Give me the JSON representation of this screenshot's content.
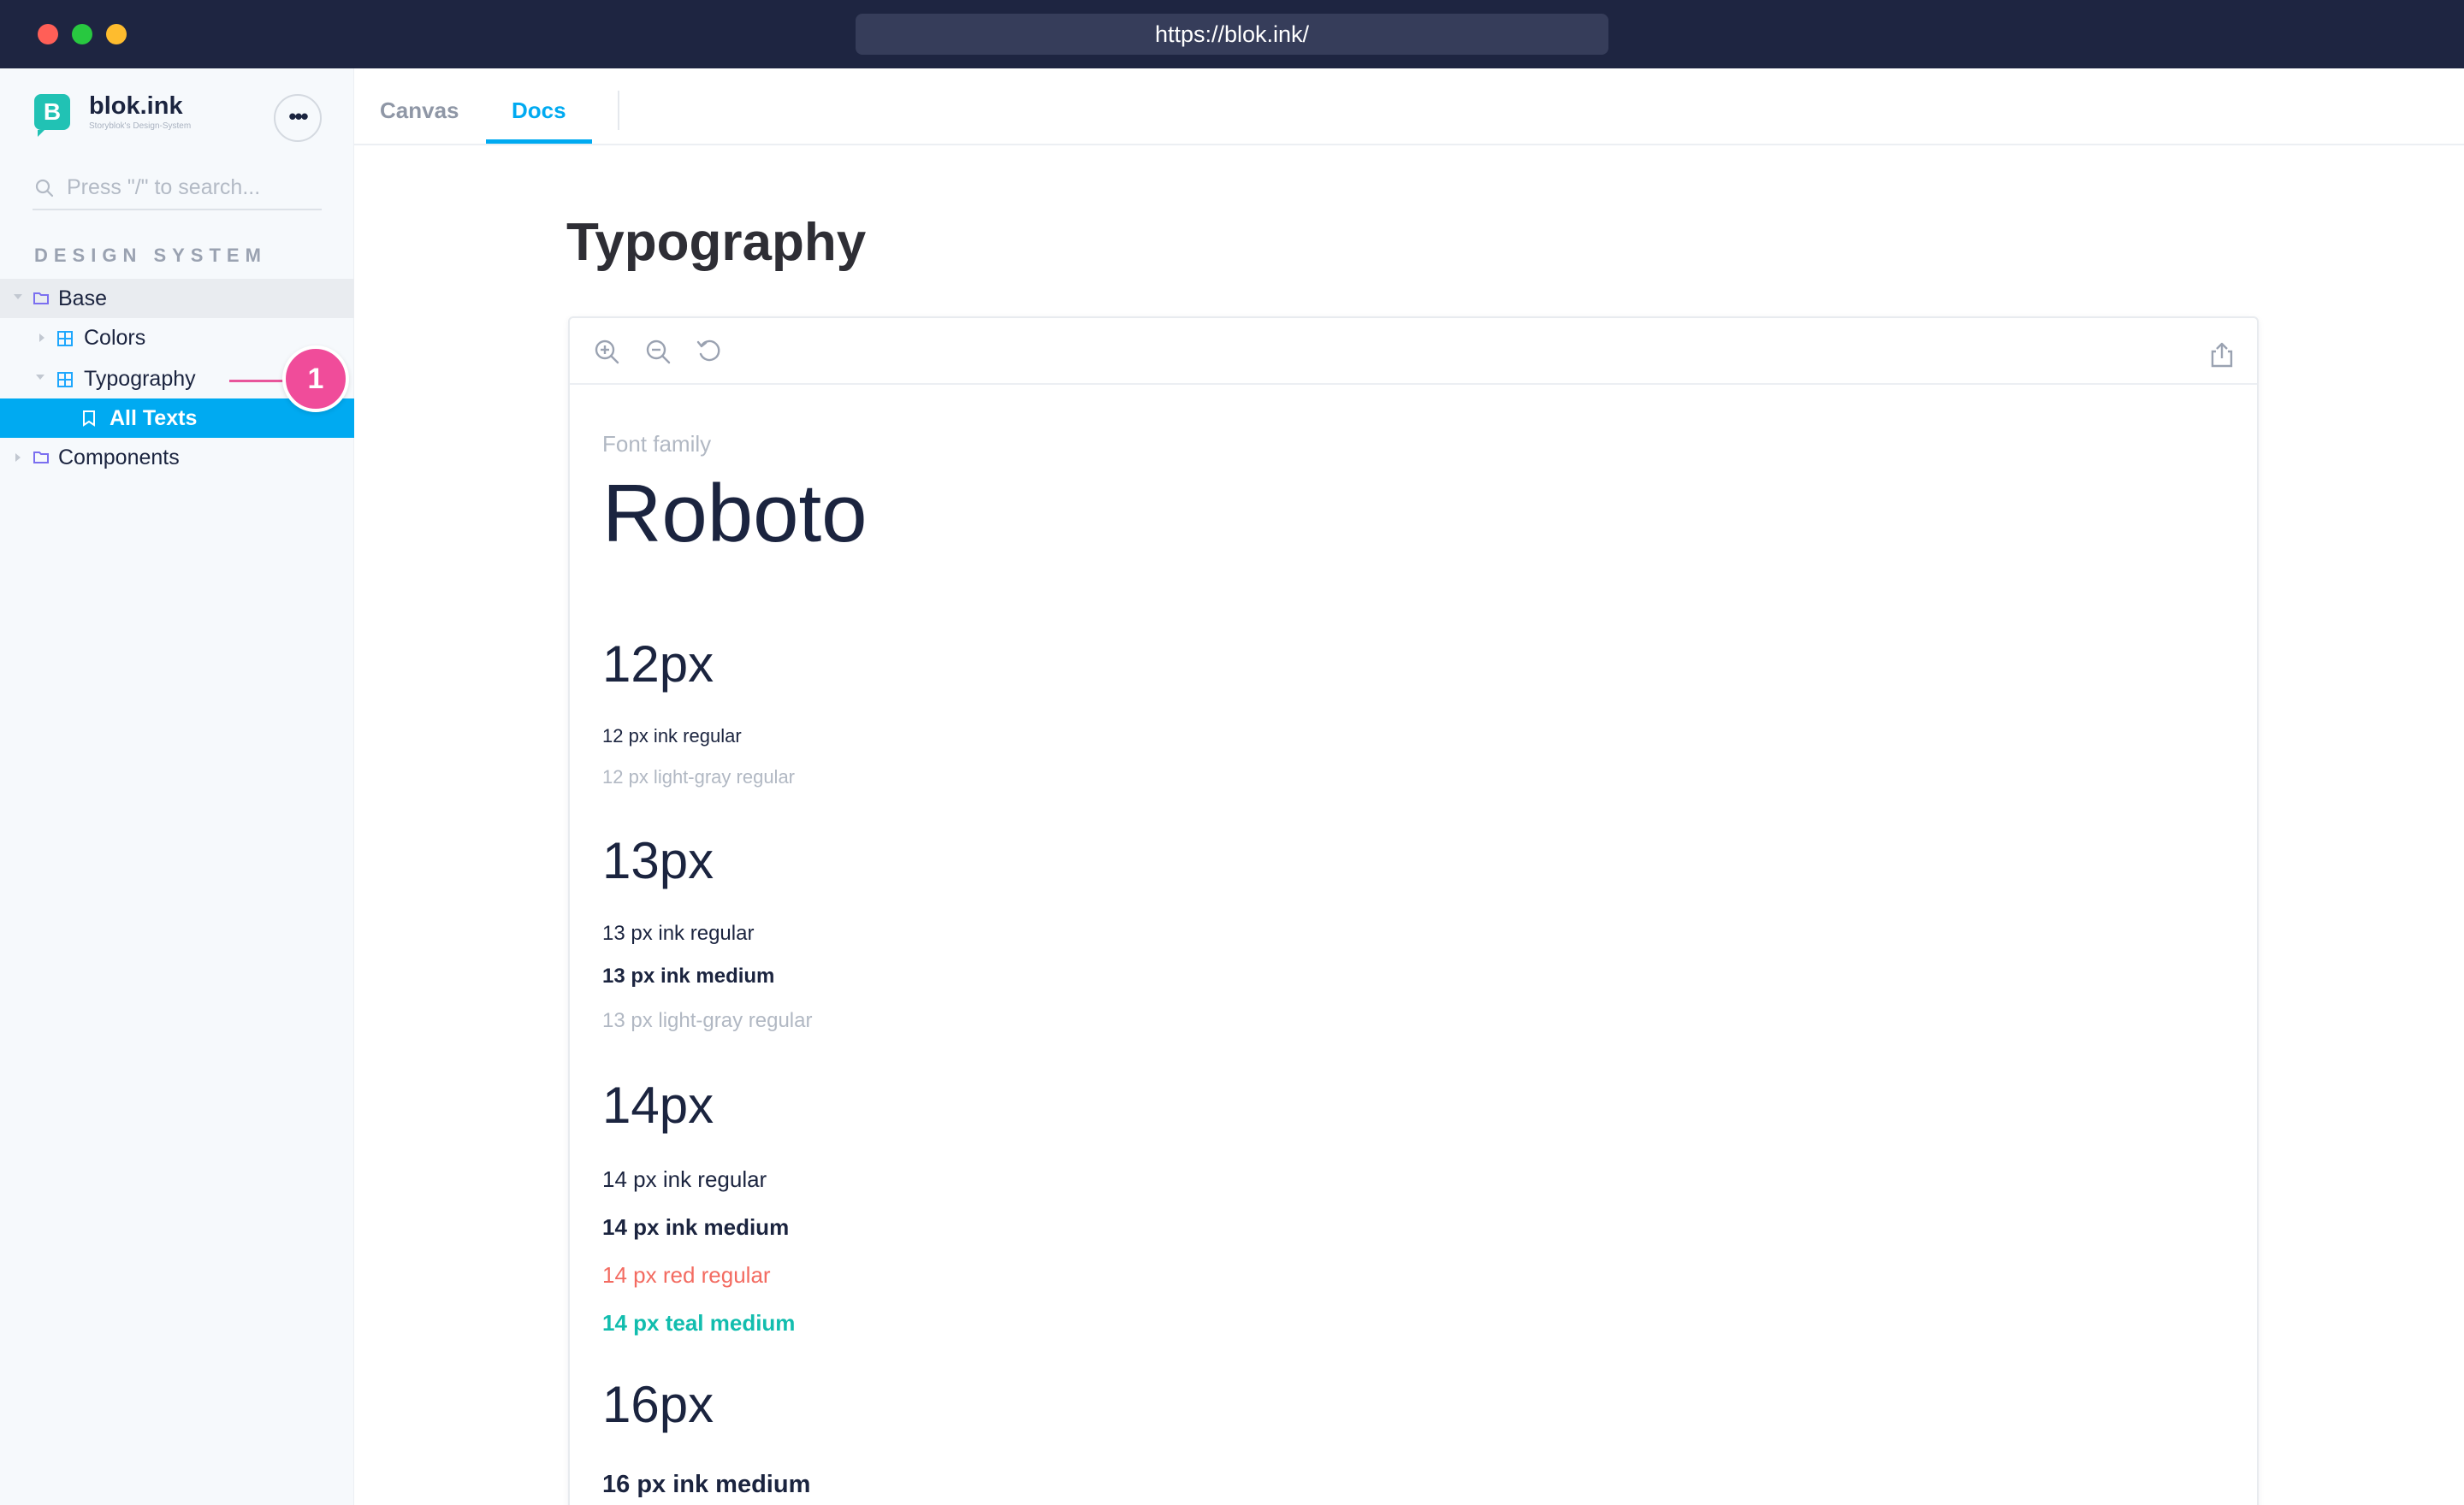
{
  "browser": {
    "url": "https://blok.ink/"
  },
  "sidebar": {
    "brand": "blok.ink",
    "brand_subtitle": "Storyblok's Design-System",
    "search_placeholder": "Press \"/\" to search...",
    "section_heading": "DESIGN SYSTEM",
    "items": [
      {
        "label": "Base",
        "icon": "folder-icon"
      },
      {
        "label": "Colors",
        "icon": "component-icon"
      },
      {
        "label": "Typography",
        "icon": "component-icon"
      },
      {
        "label": "All Texts",
        "icon": "bookmark-icon",
        "selected": true
      },
      {
        "label": "Components",
        "icon": "folder-icon"
      }
    ],
    "annotation_badge": "1"
  },
  "tabs": [
    {
      "label": "Canvas",
      "active": false
    },
    {
      "label": "Docs",
      "active": true
    }
  ],
  "main": {
    "title": "Typography"
  },
  "preview": {
    "toolbar_icons": [
      "zoom-in-icon",
      "zoom-out-icon",
      "reset-zoom-icon",
      "share-icon"
    ],
    "font_family_label": "Font family",
    "font_family_name": "Roboto",
    "sections": [
      {
        "heading": "12px",
        "samples": [
          {
            "text": "12 px ink regular",
            "color": "ink"
          },
          {
            "text": "12 px light-gray regular",
            "color": "light-gray"
          }
        ]
      },
      {
        "heading": "13px",
        "samples": [
          {
            "text": "13 px ink regular",
            "color": "ink"
          },
          {
            "text": "13 px ink medium",
            "color": "ink"
          },
          {
            "text": "13 px light-gray regular",
            "color": "light-gray"
          }
        ]
      },
      {
        "heading": "14px",
        "samples": [
          {
            "text": "14 px ink regular",
            "color": "ink"
          },
          {
            "text": "14 px ink medium",
            "color": "ink"
          },
          {
            "text": "14 px red regular",
            "color": "red"
          },
          {
            "text": "14 px teal medium",
            "color": "teal"
          }
        ]
      },
      {
        "heading": "16px",
        "samples": [
          {
            "text": "16 px ink medium",
            "color": "ink"
          }
        ]
      }
    ]
  },
  "colors": {
    "ink": "#1b243f",
    "light_gray": "#b1b8c3",
    "red": "#f36b61",
    "teal": "#12bdae",
    "accent_blue": "#00aaf1",
    "annotation_pink": "#f04c9a",
    "brand_teal": "#21c2b4"
  }
}
